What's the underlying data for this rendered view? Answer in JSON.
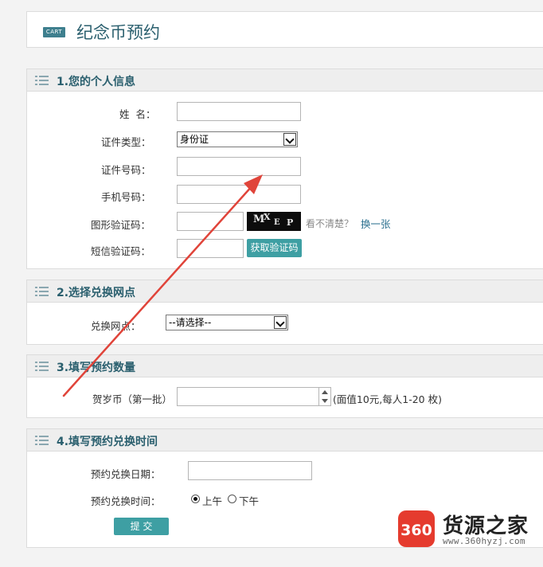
{
  "header": {
    "icon_text": "CART",
    "title": "纪念币预约"
  },
  "section1": {
    "title": "1.您的个人信息",
    "name_label": "姓  名：",
    "id_type_label": "证件类型：",
    "id_type_value": "身份证",
    "id_number_label": "证件号码：",
    "phone_label": "手机号码：",
    "captcha_label": "图形验证码：",
    "captcha_chars": [
      "M",
      "X",
      "E",
      "P"
    ],
    "captcha_hint": "看不清楚？",
    "captcha_refresh": "换一张",
    "sms_label": "短信验证码：",
    "sms_button": "获取验证码"
  },
  "section2": {
    "title": "2.选择兑换网点",
    "branch_label": "兑换网点：",
    "branch_value": "--请选择--"
  },
  "section3": {
    "title": "3.填写预约数量",
    "coin_label": "贺岁币（第一批）",
    "coin_note": "(面值10元,每人1-20 枚)"
  },
  "section4": {
    "title": "4.填写预约兑换时间",
    "date_label": "预约兑换日期：",
    "time_label": "预约兑换时间：",
    "time_am": "上午",
    "time_pm": "下午",
    "submit": "提  交"
  },
  "watermark": {
    "logo_text": "360",
    "brand": "货源之家",
    "url": "www.360hyzj.com"
  },
  "colors": {
    "accent": "#3e9fa3",
    "title": "#2a5f6e",
    "arrow": "#e0443a"
  }
}
